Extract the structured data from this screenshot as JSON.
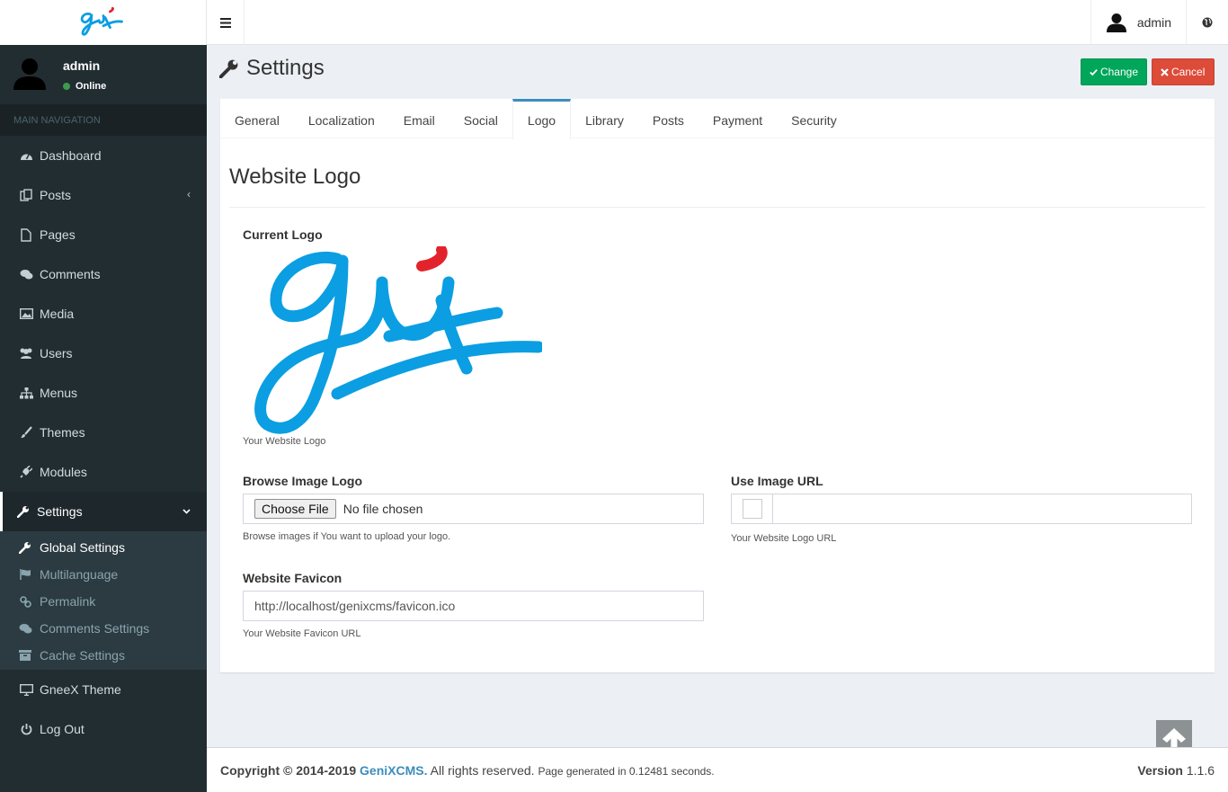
{
  "header": {
    "user_name": "admin"
  },
  "sidebar": {
    "user": {
      "name": "admin",
      "status": "Online"
    },
    "nav_header": "MAIN NAVIGATION",
    "items": [
      {
        "label": "Dashboard",
        "icon": "dashboard-icon"
      },
      {
        "label": "Posts",
        "icon": "posts-icon"
      },
      {
        "label": "Pages",
        "icon": "file-icon"
      },
      {
        "label": "Comments",
        "icon": "comments-icon"
      },
      {
        "label": "Media",
        "icon": "image-icon"
      },
      {
        "label": "Users",
        "icon": "users-icon"
      },
      {
        "label": "Menus",
        "icon": "sitemap-icon"
      },
      {
        "label": "Themes",
        "icon": "paint-brush-icon"
      },
      {
        "label": "Modules",
        "icon": "plug-icon"
      },
      {
        "label": "Settings",
        "icon": "wrench-icon"
      },
      {
        "label": "GneeX Theme",
        "icon": "desktop-icon"
      },
      {
        "label": "Log Out",
        "icon": "power-icon"
      }
    ],
    "settings_submenu": [
      {
        "label": "Global Settings",
        "icon": "wrench-icon"
      },
      {
        "label": "Multilanguage",
        "icon": "flag-icon"
      },
      {
        "label": "Permalink",
        "icon": "link-icon"
      },
      {
        "label": "Comments Settings",
        "icon": "comments-icon"
      },
      {
        "label": "Cache Settings",
        "icon": "archive-icon"
      }
    ]
  },
  "page": {
    "title": "Settings",
    "change_label": "Change",
    "cancel_label": "Cancel"
  },
  "tabs": [
    "General",
    "Localization",
    "Email",
    "Social",
    "Logo",
    "Library",
    "Posts",
    "Payment",
    "Security"
  ],
  "active_tab": "Logo",
  "logo_section": {
    "title": "Website Logo",
    "current_logo_label": "Current Logo",
    "current_logo_help": "Your Website Logo",
    "browse_label": "Browse Image Logo",
    "choose_file": "Choose File",
    "no_file": "No file chosen",
    "browse_help": "Browse images if You want to upload your logo.",
    "url_label": "Use Image URL",
    "url_help": "Your Website Logo URL",
    "favicon_label": "Website Favicon",
    "favicon_value": "http://localhost/genixcms/favicon.ico",
    "favicon_help": "Your Website Favicon URL"
  },
  "footer": {
    "copyright": "Copyright © 2014-2019",
    "brand": "GeniXCMS.",
    "rights": "All rights reserved.",
    "generated": "Page generated in 0.12481 seconds.",
    "version_label": "Version",
    "version": "1.1.6"
  },
  "colors": {
    "sidebar_bg": "#222d32",
    "primary": "#3c8dbc",
    "success": "#00a65a",
    "danger": "#dd4b39",
    "logo_blue": "#0b9ee2",
    "logo_red": "#e3232c"
  }
}
